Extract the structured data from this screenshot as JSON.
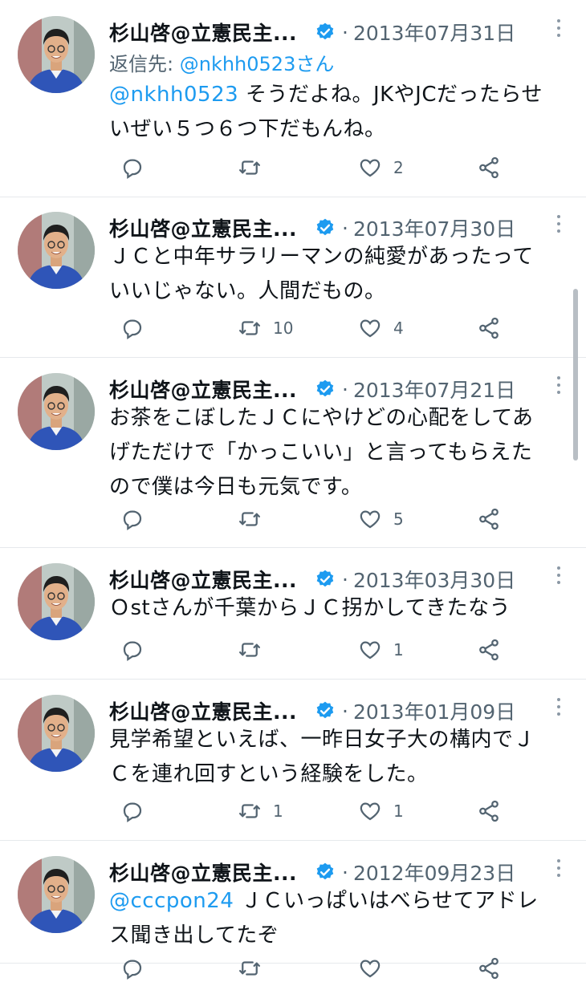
{
  "tweets": [
    {
      "name": "杉山啓@立憲民主...",
      "date": "2013年07月31日",
      "reply_to_label": "返信先:",
      "reply_to_user": "@nkhh0523さん",
      "mention": "@nkhh0523",
      "lines": [
        "そうだよね。JKやJCだったらせ",
        "いぜい５つ６つ下だもんね。"
      ],
      "replies": "",
      "retweets": "",
      "likes": "2"
    },
    {
      "name": "杉山啓@立憲民主...",
      "date": "2013年07月30日",
      "mention": "",
      "lines": [
        "ＪＣと中年サラリーマンの純愛があったって",
        "いいじゃない。人間だもの。"
      ],
      "replies": "",
      "retweets": "10",
      "likes": "4"
    },
    {
      "name": "杉山啓@立憲民主...",
      "date": "2013年07月21日",
      "mention": "",
      "lines": [
        "お茶をこぼしたＪＣにやけどの心配をしてあ",
        "げただけで「かっこいい」と言ってもらえた",
        "ので僕は今日も元気です。"
      ],
      "replies": "",
      "retweets": "",
      "likes": "5"
    },
    {
      "name": "杉山啓@立憲民主...",
      "date": "2013年03月30日",
      "mention": "",
      "lines": [
        "Ｏstさんが千葉からＪＣ拐かしてきたなう"
      ],
      "replies": "",
      "retweets": "",
      "likes": "1"
    },
    {
      "name": "杉山啓@立憲民主...",
      "date": "2013年01月09日",
      "mention": "",
      "lines": [
        "見学希望といえば、一昨日女子大の構内でＪ",
        "Ｃを連れ回すという経験をした。"
      ],
      "replies": "",
      "retweets": "1",
      "likes": "1"
    },
    {
      "name": "杉山啓@立憲民主...",
      "date": "2012年09月23日",
      "mention": "@cccpon24",
      "lines": [
        "ＪＣいっぱいはべらせてアドレ",
        "ス聞き出してたぞ"
      ],
      "replies": "",
      "retweets": "",
      "likes": ""
    }
  ],
  "icons": {
    "verified": "verified-badge-icon",
    "more": "more-vertical-icon",
    "reply": "reply-bubble-icon",
    "retweet": "retweet-arrows-icon",
    "like": "heart-icon",
    "share": "share-icon"
  },
  "colors": {
    "accent": "#1d9bf0",
    "muted": "#536471",
    "text": "#0f1419",
    "divider": "#e6e9ec"
  }
}
